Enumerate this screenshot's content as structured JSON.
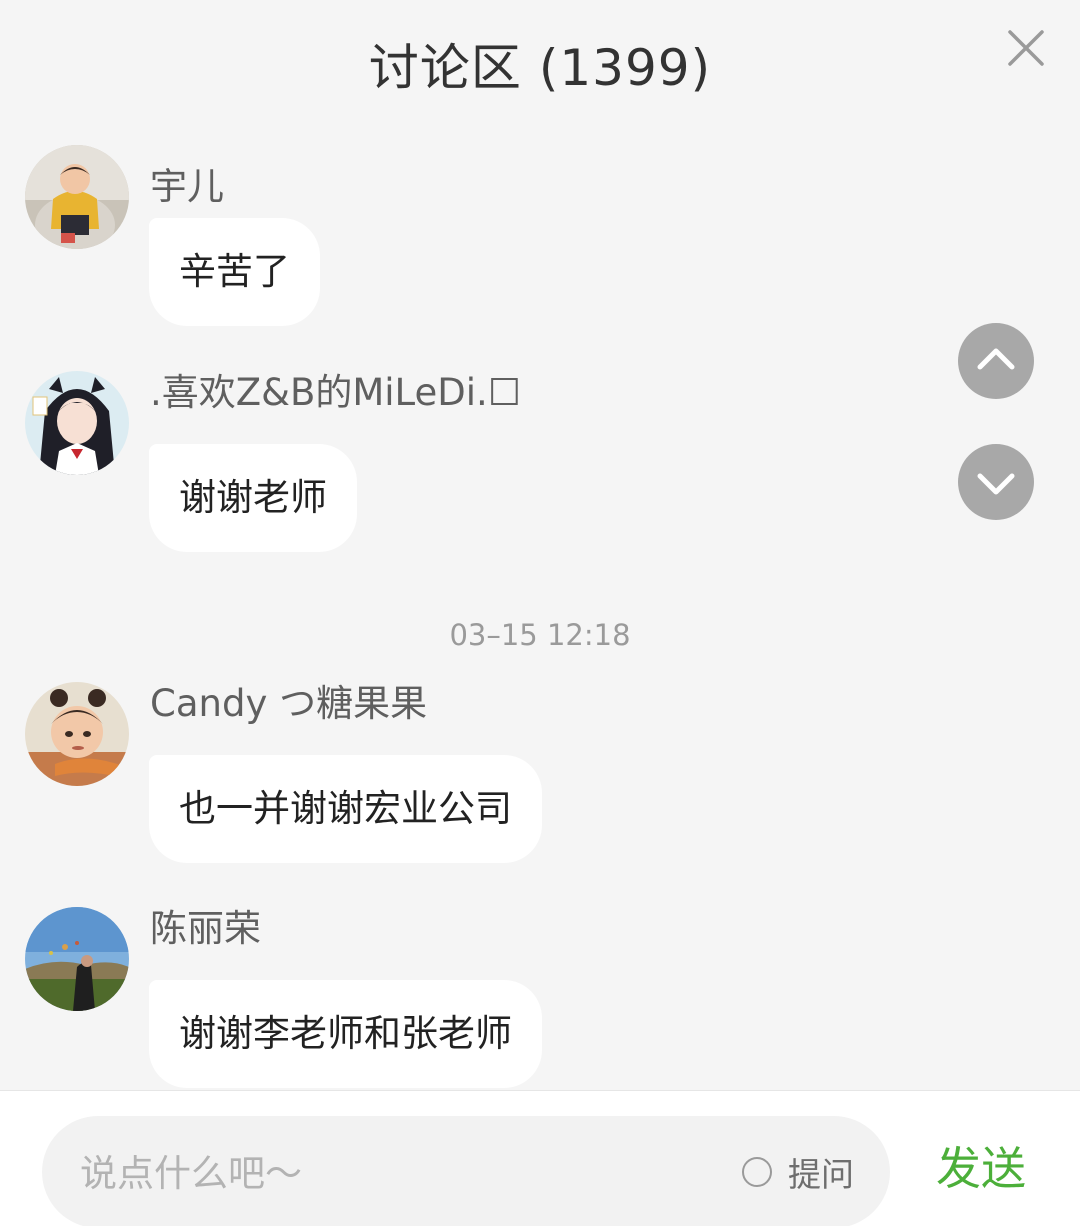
{
  "header": {
    "title": "讨论区 (1399)",
    "close_icon": "close-icon"
  },
  "messages": [
    {
      "nickname": "宇儿",
      "text": "辛苦了",
      "avatar": "child-photo-avatar"
    },
    {
      "nickname": ".喜欢Z&B的MiLeDi.☐",
      "text": "谢谢老师",
      "avatar": "anime-girl-avatar"
    },
    {
      "nickname": "Candy つ糖果果",
      "text": "也一并谢谢宏业公司",
      "avatar": "cartoon-girl-avatar"
    },
    {
      "nickname": "陈丽荣",
      "text": "谢谢李老师和张老师",
      "avatar": "balloon-landscape-avatar"
    }
  ],
  "timestamp": "03–15 12:18",
  "scroll": {
    "up_icon": "chevron-up-icon",
    "down_icon": "chevron-down-icon"
  },
  "input": {
    "placeholder": "说点什么吧～",
    "value": "",
    "ask_label": "提问",
    "ask_checked": false,
    "send_label": "发送"
  },
  "colors": {
    "background": "#f5f5f5",
    "bubble": "#ffffff",
    "send": "#4caf3a",
    "scroll_button": "#a8a8a8"
  }
}
